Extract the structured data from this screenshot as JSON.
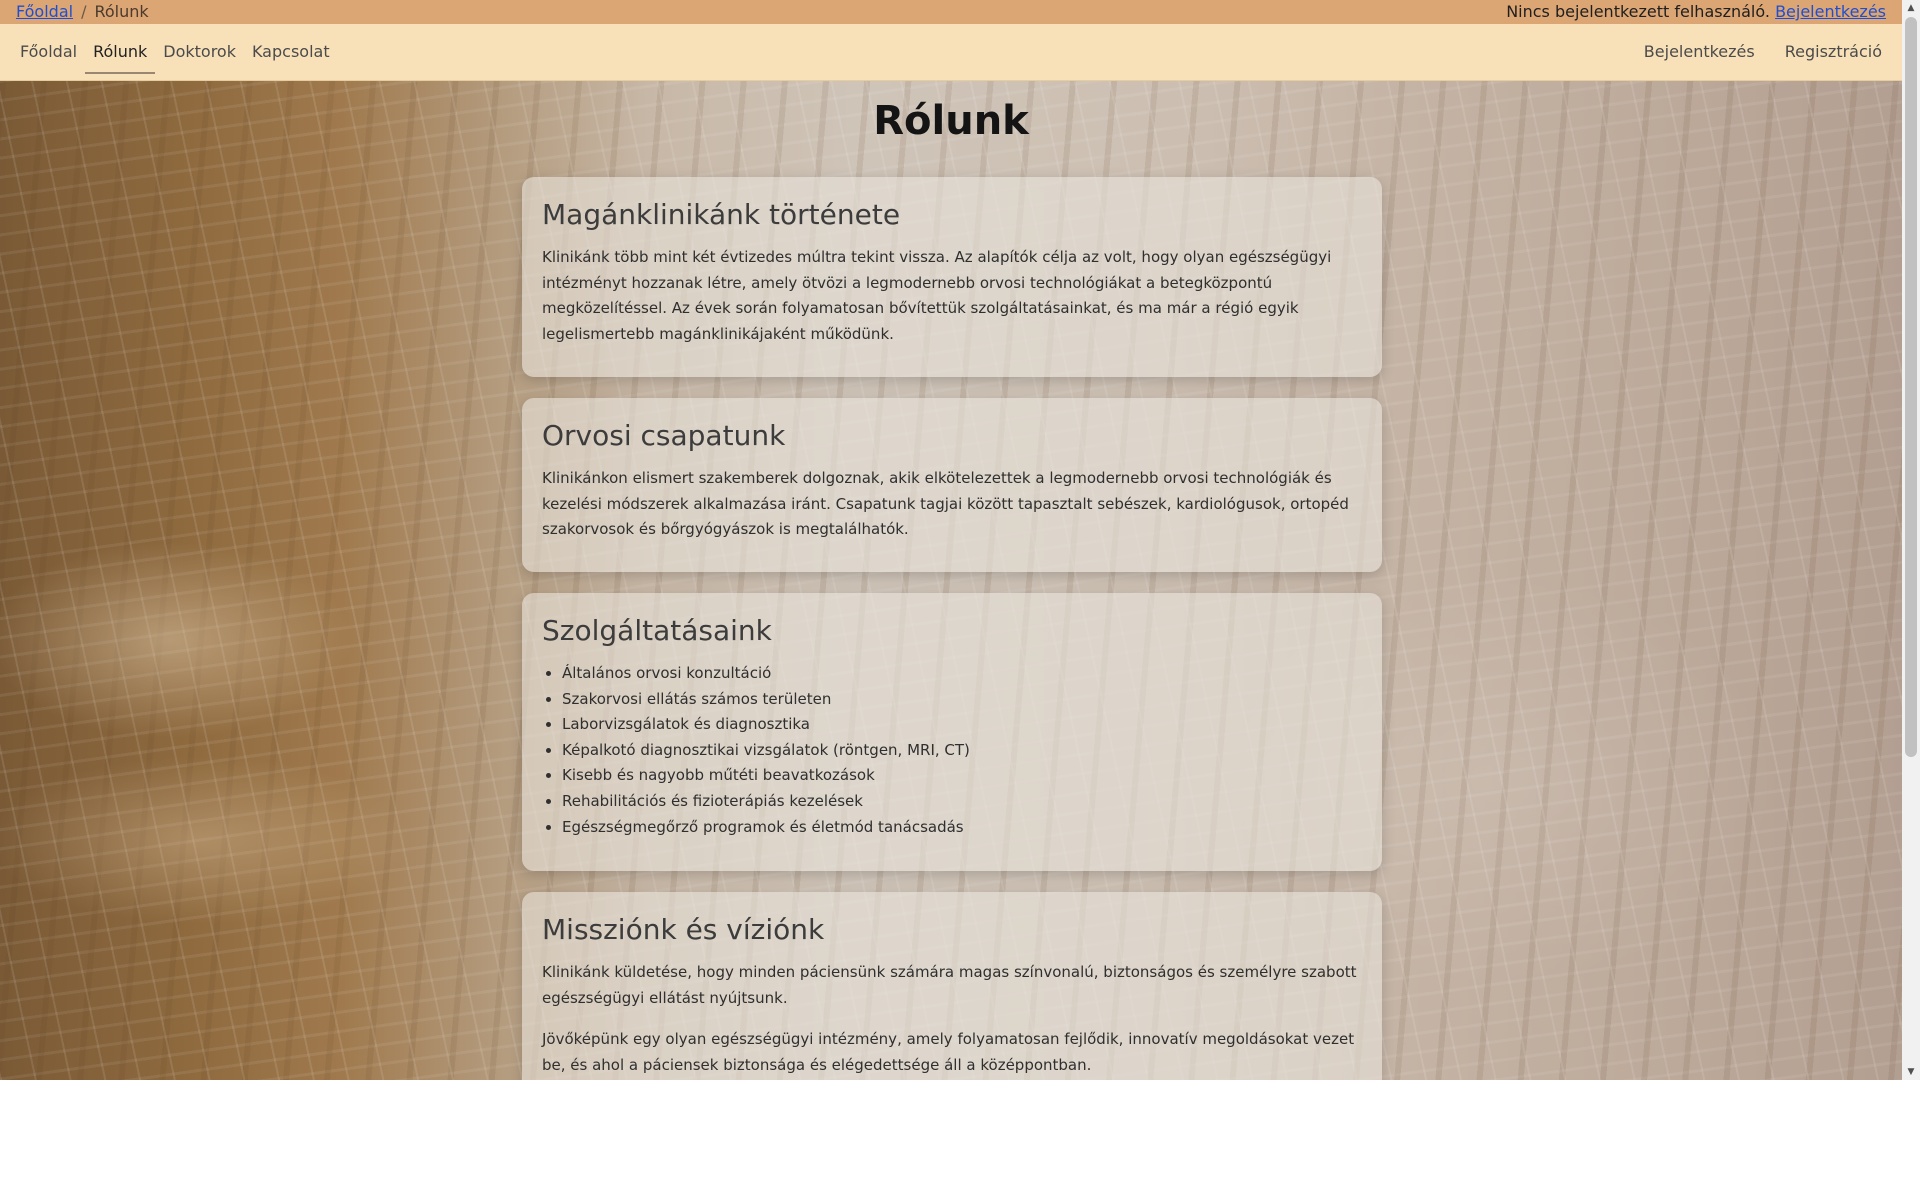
{
  "topbar": {
    "breadcrumb": {
      "home": "Főoldal",
      "separator": "/",
      "current": "Rólunk"
    },
    "status_text": "Nincs bejelentkezett felhasználó.",
    "login_link": "Bejelentkezés"
  },
  "nav": {
    "left": [
      "Főoldal",
      "Rólunk",
      "Doktorok",
      "Kapcsolat"
    ],
    "active": "Rólunk",
    "right": [
      "Bejelentkezés",
      "Regisztráció"
    ]
  },
  "page": {
    "title": "Rólunk"
  },
  "sections": [
    {
      "heading": "Magánklinikánk története",
      "paragraphs": [
        "Klinikánk több mint két évtizedes múltra tekint vissza. Az alapítók célja az volt, hogy olyan egészségügyi intézményt hozzanak létre, amely ötvözi a legmodernebb orvosi technológiákat a betegközpontú megközelítéssel. Az évek során folyamatosan bővítettük szolgáltatásainkat, és ma már a régió egyik legelismertebb magánklinikájaként működünk."
      ]
    },
    {
      "heading": "Orvosi csapatunk",
      "paragraphs": [
        "Klinikánkon elismert szakemberek dolgoznak, akik elkötelezettek a legmodernebb orvosi technológiák és kezelési módszerek alkalmazása iránt. Csapatunk tagjai között tapasztalt sebészek, kardiológusok, ortopéd szakorvosok és bőrgyógyászok is megtalálhatók."
      ]
    },
    {
      "heading": "Szolgáltatásaink",
      "items": [
        "Általános orvosi konzultáció",
        "Szakorvosi ellátás számos területen",
        "Laborvizsgálatok és diagnosztika",
        "Képalkotó diagnosztikai vizsgálatok (röntgen, MRI, CT)",
        "Kisebb és nagyobb műtéti beavatkozások",
        "Rehabilitációs és fizioterápiás kezelések",
        "Egészségmegőrző programok és életmód tanácsadás"
      ]
    },
    {
      "heading": "Missziónk és víziónk",
      "paragraphs": [
        "Klinikánk küldetése, hogy minden páciensünk számára magas színvonalú, biztonságos és személyre szabott egészségügyi ellátást nyújtsunk.",
        "Jövőképünk egy olyan egészségügyi intézmény, amely folyamatosan fejlődik, innovatív megoldásokat vezet be, és ahol a páciensek biztonsága és elégedettsége áll a középpontban."
      ]
    }
  ],
  "colors": {
    "topbar": "#dba574",
    "navbar": "#f8e1b8",
    "link": "#1f4fd0",
    "card": "#e8e2da"
  },
  "icons": {
    "scroll_up": "triangle-up-icon",
    "scroll_down": "triangle-down-icon"
  }
}
